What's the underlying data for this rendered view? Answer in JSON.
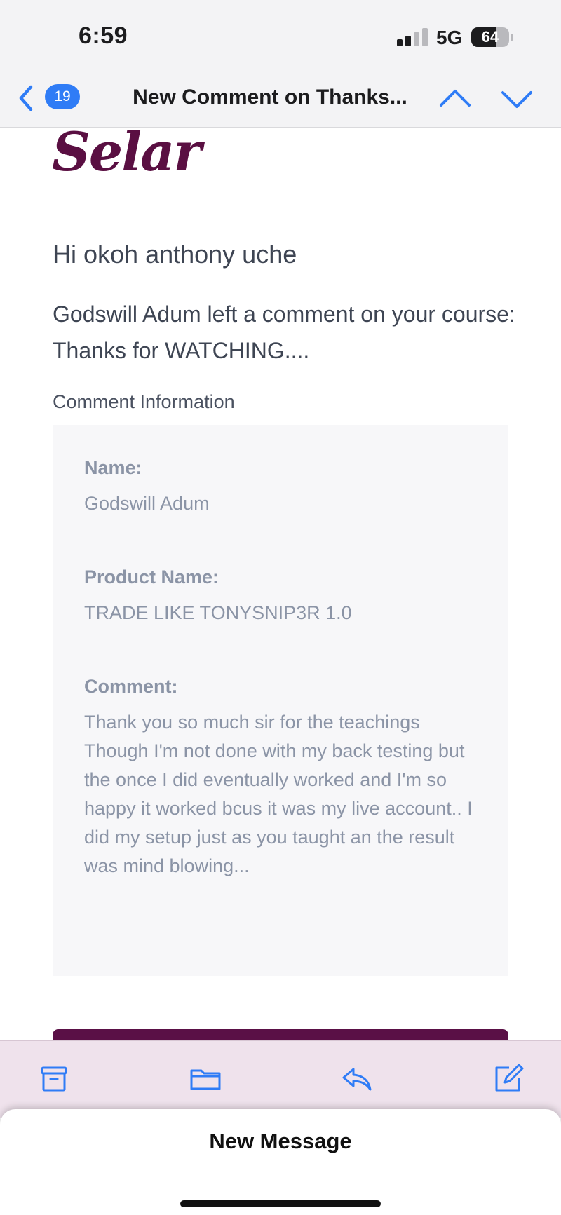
{
  "status_bar": {
    "time": "6:59",
    "network": "5G",
    "battery": "64",
    "battery_level": 0.64
  },
  "nav": {
    "unread_count": "19",
    "title": "New Comment on Thanks..."
  },
  "email": {
    "brand": "Selar",
    "greeting": "Hi okoh anthony uche",
    "intro": "Godswill Adum left a comment on your course: Thanks for WATCHING....",
    "section_label": "Comment Information",
    "fields": [
      {
        "label": "Name:",
        "value": "Godswill Adum"
      },
      {
        "label": "Product Name:",
        "value": "TRADE LIKE TONYSNIP3R 1.0"
      },
      {
        "label": "Comment:",
        "value": "Thank you so much sir for the teachings Though I'm not done with my back testing but the once I did eventually worked and I'm so happy it worked bcus it was my live account.. I did my setup just as you taught an the result was mind blowing..."
      }
    ]
  },
  "toolbar": {
    "icons": [
      "archive-icon",
      "folder-icon",
      "reply-icon",
      "compose-icon"
    ]
  },
  "draft": {
    "title": "New Message"
  },
  "colors": {
    "accent": "#2f7cf6",
    "brand": "#5a0f42",
    "muted_text": "#8b94a6"
  }
}
